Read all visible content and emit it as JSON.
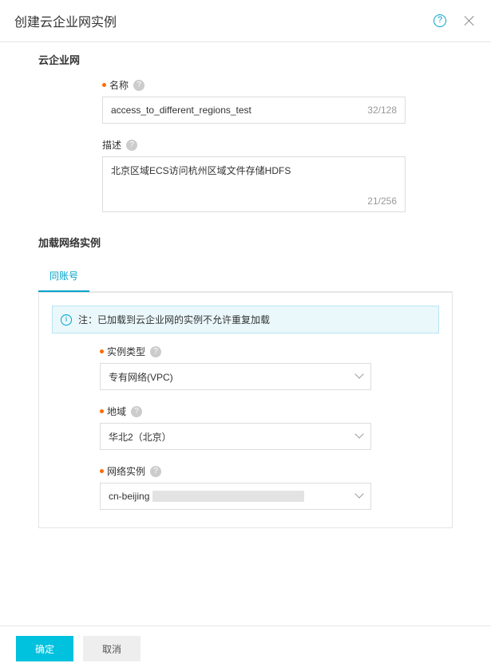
{
  "dialog": {
    "title": "创建云企业网实例"
  },
  "section1": {
    "title": "云企业网",
    "name": {
      "label": "名称",
      "value": "access_to_different_regions_test",
      "count": "32/128"
    },
    "desc": {
      "label": "描述",
      "value": "北京区域ECS访问杭州区域文件存储HDFS",
      "count": "21/256"
    }
  },
  "section2": {
    "title": "加载网络实例",
    "tab": "同账号",
    "notice": "注：已加载到云企业网的实例不允许重复加载",
    "instanceType": {
      "label": "实例类型",
      "value": "专有网络(VPC)"
    },
    "region": {
      "label": "地域",
      "value": "华北2（北京）"
    },
    "networkInstance": {
      "label": "网络实例",
      "value": "cn-beijing"
    }
  },
  "footer": {
    "ok": "确定",
    "cancel": "取消"
  }
}
